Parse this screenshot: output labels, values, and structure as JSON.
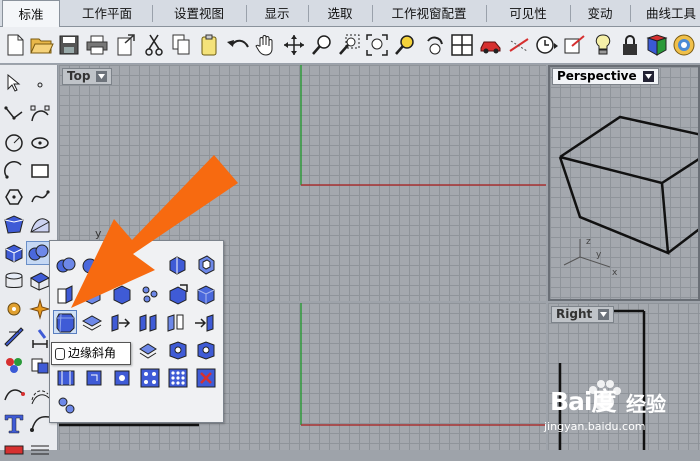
{
  "tabs": [
    {
      "label": "标准",
      "active": true
    },
    {
      "label": "工作平面",
      "active": false
    },
    {
      "label": "设置视图",
      "active": false
    },
    {
      "label": "显示",
      "active": false
    },
    {
      "label": "选取",
      "active": false
    },
    {
      "label": "工作视窗配置",
      "active": false
    },
    {
      "label": "可见性",
      "active": false
    },
    {
      "label": "变动",
      "active": false
    },
    {
      "label": "曲线工具",
      "active": false
    }
  ],
  "viewports": {
    "top": {
      "label": "Top"
    },
    "perspective": {
      "label": "Perspective"
    },
    "right": {
      "label": "Right"
    }
  },
  "axes": {
    "x": "x",
    "y": "y",
    "z": "z"
  },
  "tooltip": {
    "text": "边缘斜角"
  },
  "watermark": {
    "brand": "Bai度",
    "cn": "经验",
    "url": "jingyan.baidu.com"
  },
  "colors": {
    "arrow": "#f76a10",
    "x_axis": "#a83232",
    "y_axis": "#2f9a3a",
    "solid_blue": "#3f5bd6",
    "viewport_bg": "#a4a8ae"
  }
}
